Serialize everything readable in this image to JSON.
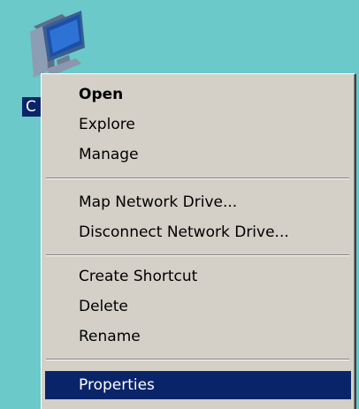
{
  "desktop": {
    "background_color": "#6bc9c9",
    "icon": {
      "icon_name": "my-computer-icon",
      "label": "C"
    }
  },
  "context_menu": {
    "highlight_color": "#0a246a",
    "items": [
      {
        "label": "Open",
        "bold": true
      },
      {
        "label": "Explore"
      },
      {
        "label": "Manage"
      },
      {
        "label": "Map Network Drive..."
      },
      {
        "label": "Disconnect Network Drive..."
      },
      {
        "label": "Create Shortcut"
      },
      {
        "label": "Delete"
      },
      {
        "label": "Rename"
      },
      {
        "label": "Properties",
        "highlighted": true
      }
    ]
  }
}
